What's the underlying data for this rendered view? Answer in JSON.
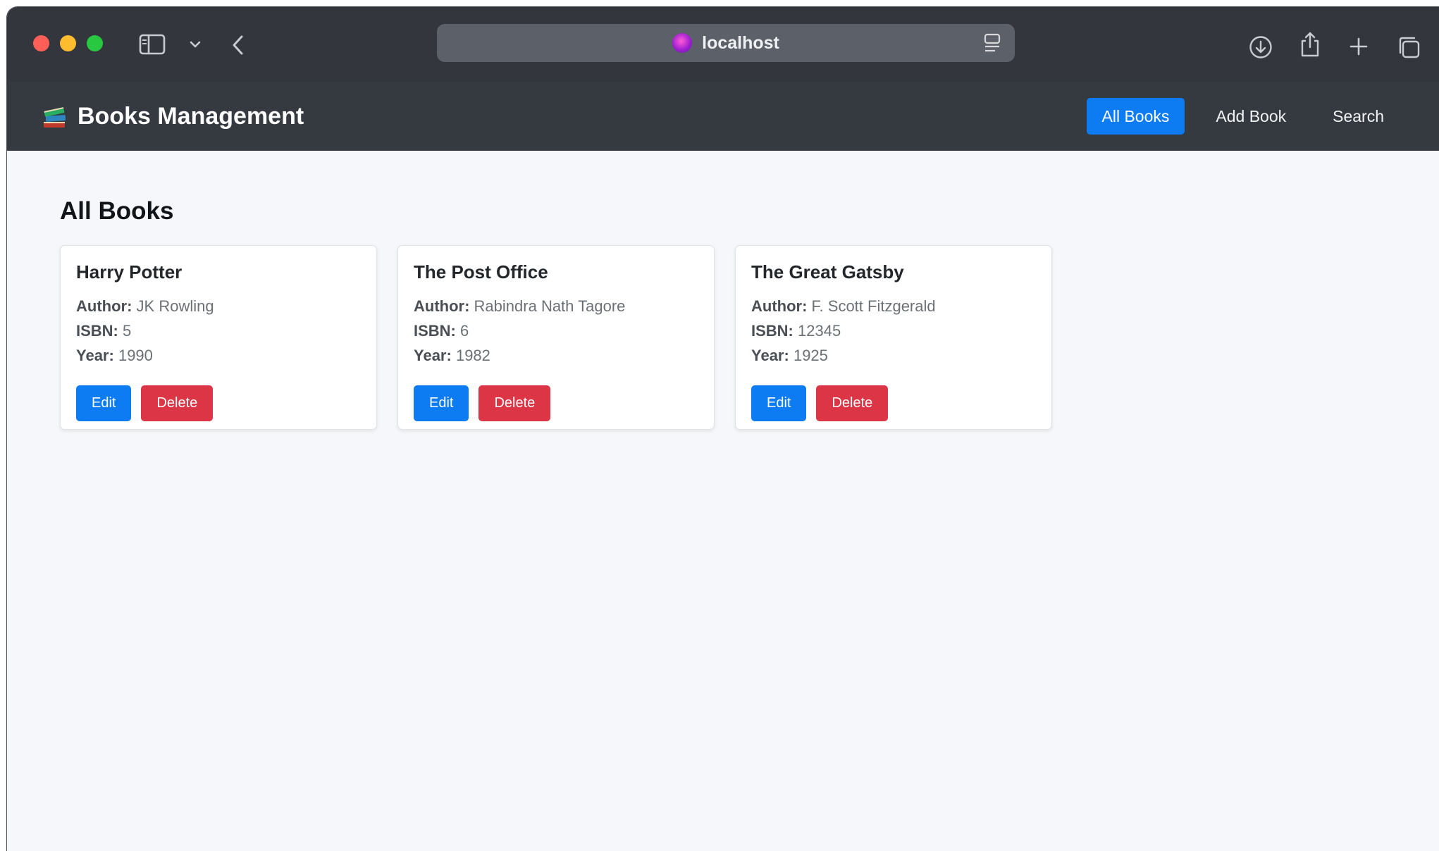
{
  "browser": {
    "address": "localhost"
  },
  "navbar": {
    "brand": "Books Management",
    "links": [
      {
        "label": "All Books",
        "active": true
      },
      {
        "label": "Add Book",
        "active": false
      },
      {
        "label": "Search",
        "active": false
      }
    ]
  },
  "main": {
    "title": "All Books",
    "labels": {
      "author": "Author:",
      "isbn": "ISBN:",
      "year": "Year:"
    },
    "books": [
      {
        "title": "Harry Potter",
        "author": "JK Rowling",
        "isbn": "5",
        "year": "1990"
      },
      {
        "title": "The Post Office",
        "author": "Rabindra Nath Tagore",
        "isbn": "6",
        "year": "1982"
      },
      {
        "title": "The Great Gatsby",
        "author": "F. Scott Fitzgerald",
        "isbn": "12345",
        "year": "1925"
      }
    ],
    "buttons": {
      "edit": "Edit",
      "delete": "Delete"
    }
  },
  "colors": {
    "primary": "#0d7bf2",
    "danger": "#dc3545",
    "navbar": "#343a40",
    "chrome": "#33373d"
  },
  "icons": [
    "sidebar-icon",
    "chevron-down-icon",
    "back-icon",
    "site-icon",
    "reader-icon",
    "download-icon",
    "share-icon",
    "plus-icon",
    "tabs-icon",
    "books-icon"
  ]
}
